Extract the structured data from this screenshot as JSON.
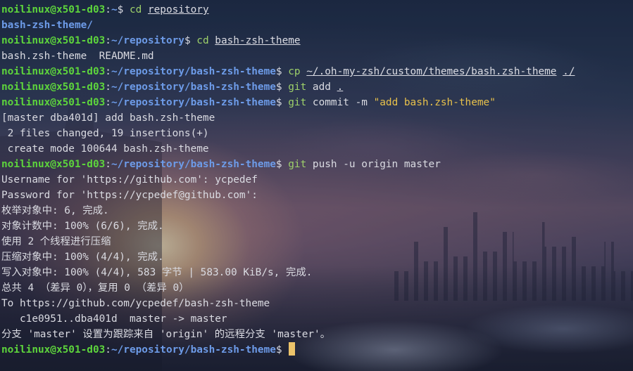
{
  "prompt": {
    "user_host": "noilinux@x501-d03",
    "separator": ":",
    "dollar": "$"
  },
  "paths": {
    "home": "~",
    "repository": "~/repository",
    "theme": "~/repository/bash-zsh-theme"
  },
  "commands": {
    "c1": {
      "name": "cd",
      "arg": "repository"
    },
    "c2": {
      "name": "cd",
      "arg": "bash-zsh-theme"
    },
    "c3": {
      "name": "cp",
      "arg1": "~/.oh-my-zsh/custom/themes/bash.zsh-theme",
      "arg2": "./"
    },
    "c4": {
      "name": "git",
      "sub": "add",
      "arg": "."
    },
    "c5": {
      "name": "git",
      "sub": "commit -m",
      "message": "\"add bash.zsh-theme\""
    },
    "c6": {
      "name": "git",
      "sub": "push -u origin master"
    }
  },
  "outputs": {
    "ls1": "bash-zsh-theme/",
    "ls2": "bash.zsh-theme  README.md",
    "commit1": "[master dba401d] add bash.zsh-theme",
    "commit2": " 2 files changed, 19 insertions(+)",
    "commit3": " create mode 100644 bash.zsh-theme",
    "push1": "Username for 'https://github.com': ycpedef",
    "push2": "Password for 'https://ycpedef@github.com':",
    "push3": "枚举对象中: 6, 完成.",
    "push4": "对象计数中: 100% (6/6), 完成.",
    "push5": "使用 2 个线程进行压缩",
    "push6": "压缩对象中: 100% (4/4), 完成.",
    "push7": "写入对象中: 100% (4/4), 583 字节 | 583.00 KiB/s, 完成.",
    "push8": "总共 4 （差异 0），复用 0 （差异 0）",
    "push9": "To https://github.com/ycpedef/bash-zsh-theme",
    "push10": "   c1e0951..dba401d  master -> master",
    "push11": "分支 'master' 设置为跟踪来自 'origin' 的远程分支 'master'。"
  },
  "colors": {
    "user": "#5dd43c",
    "path": "#6d9be8",
    "command": "#9ed16a",
    "string": "#e8c14b",
    "text": "#dadbe2",
    "cursor": "#ecc36a"
  }
}
